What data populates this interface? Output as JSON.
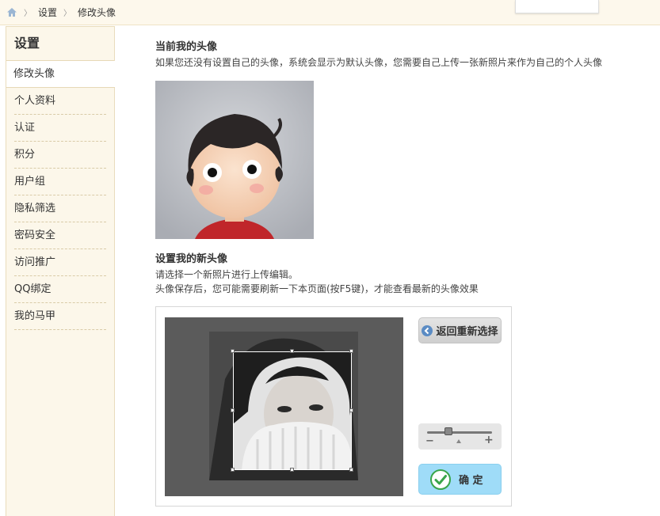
{
  "breadcrumb": {
    "home_icon": "home-icon",
    "items": [
      "设置",
      "修改头像"
    ]
  },
  "sidebar": {
    "title": "设置",
    "active": "修改头像",
    "items": [
      "个人资料",
      "认证",
      "积分",
      "用户组",
      "隐私筛选",
      "密码安全",
      "访问推广",
      "QQ绑定",
      "我的马甲"
    ]
  },
  "current_avatar": {
    "title": "当前我的头像",
    "desc": "如果您还没有设置自己的头像，系统会显示为默认头像，您需要自己上传一张新照片来作为自己的个人头像"
  },
  "new_avatar": {
    "title": "设置我的新头像",
    "desc1": "请选择一个新照片进行上传编辑。",
    "desc2": "头像保存后，您可能需要刷新一下本页面(按F5键)，才能查看最新的头像效果"
  },
  "editor": {
    "back_label": "返回重新选择",
    "zoom_minus": "−",
    "zoom_plus": "+",
    "zoom_level": 0.3,
    "confirm_label": "确 定"
  },
  "colors": {
    "accent_blue": "#9fdcf8",
    "sidebar_bg": "#fcf7ea",
    "check_green": "#3aa54a"
  }
}
